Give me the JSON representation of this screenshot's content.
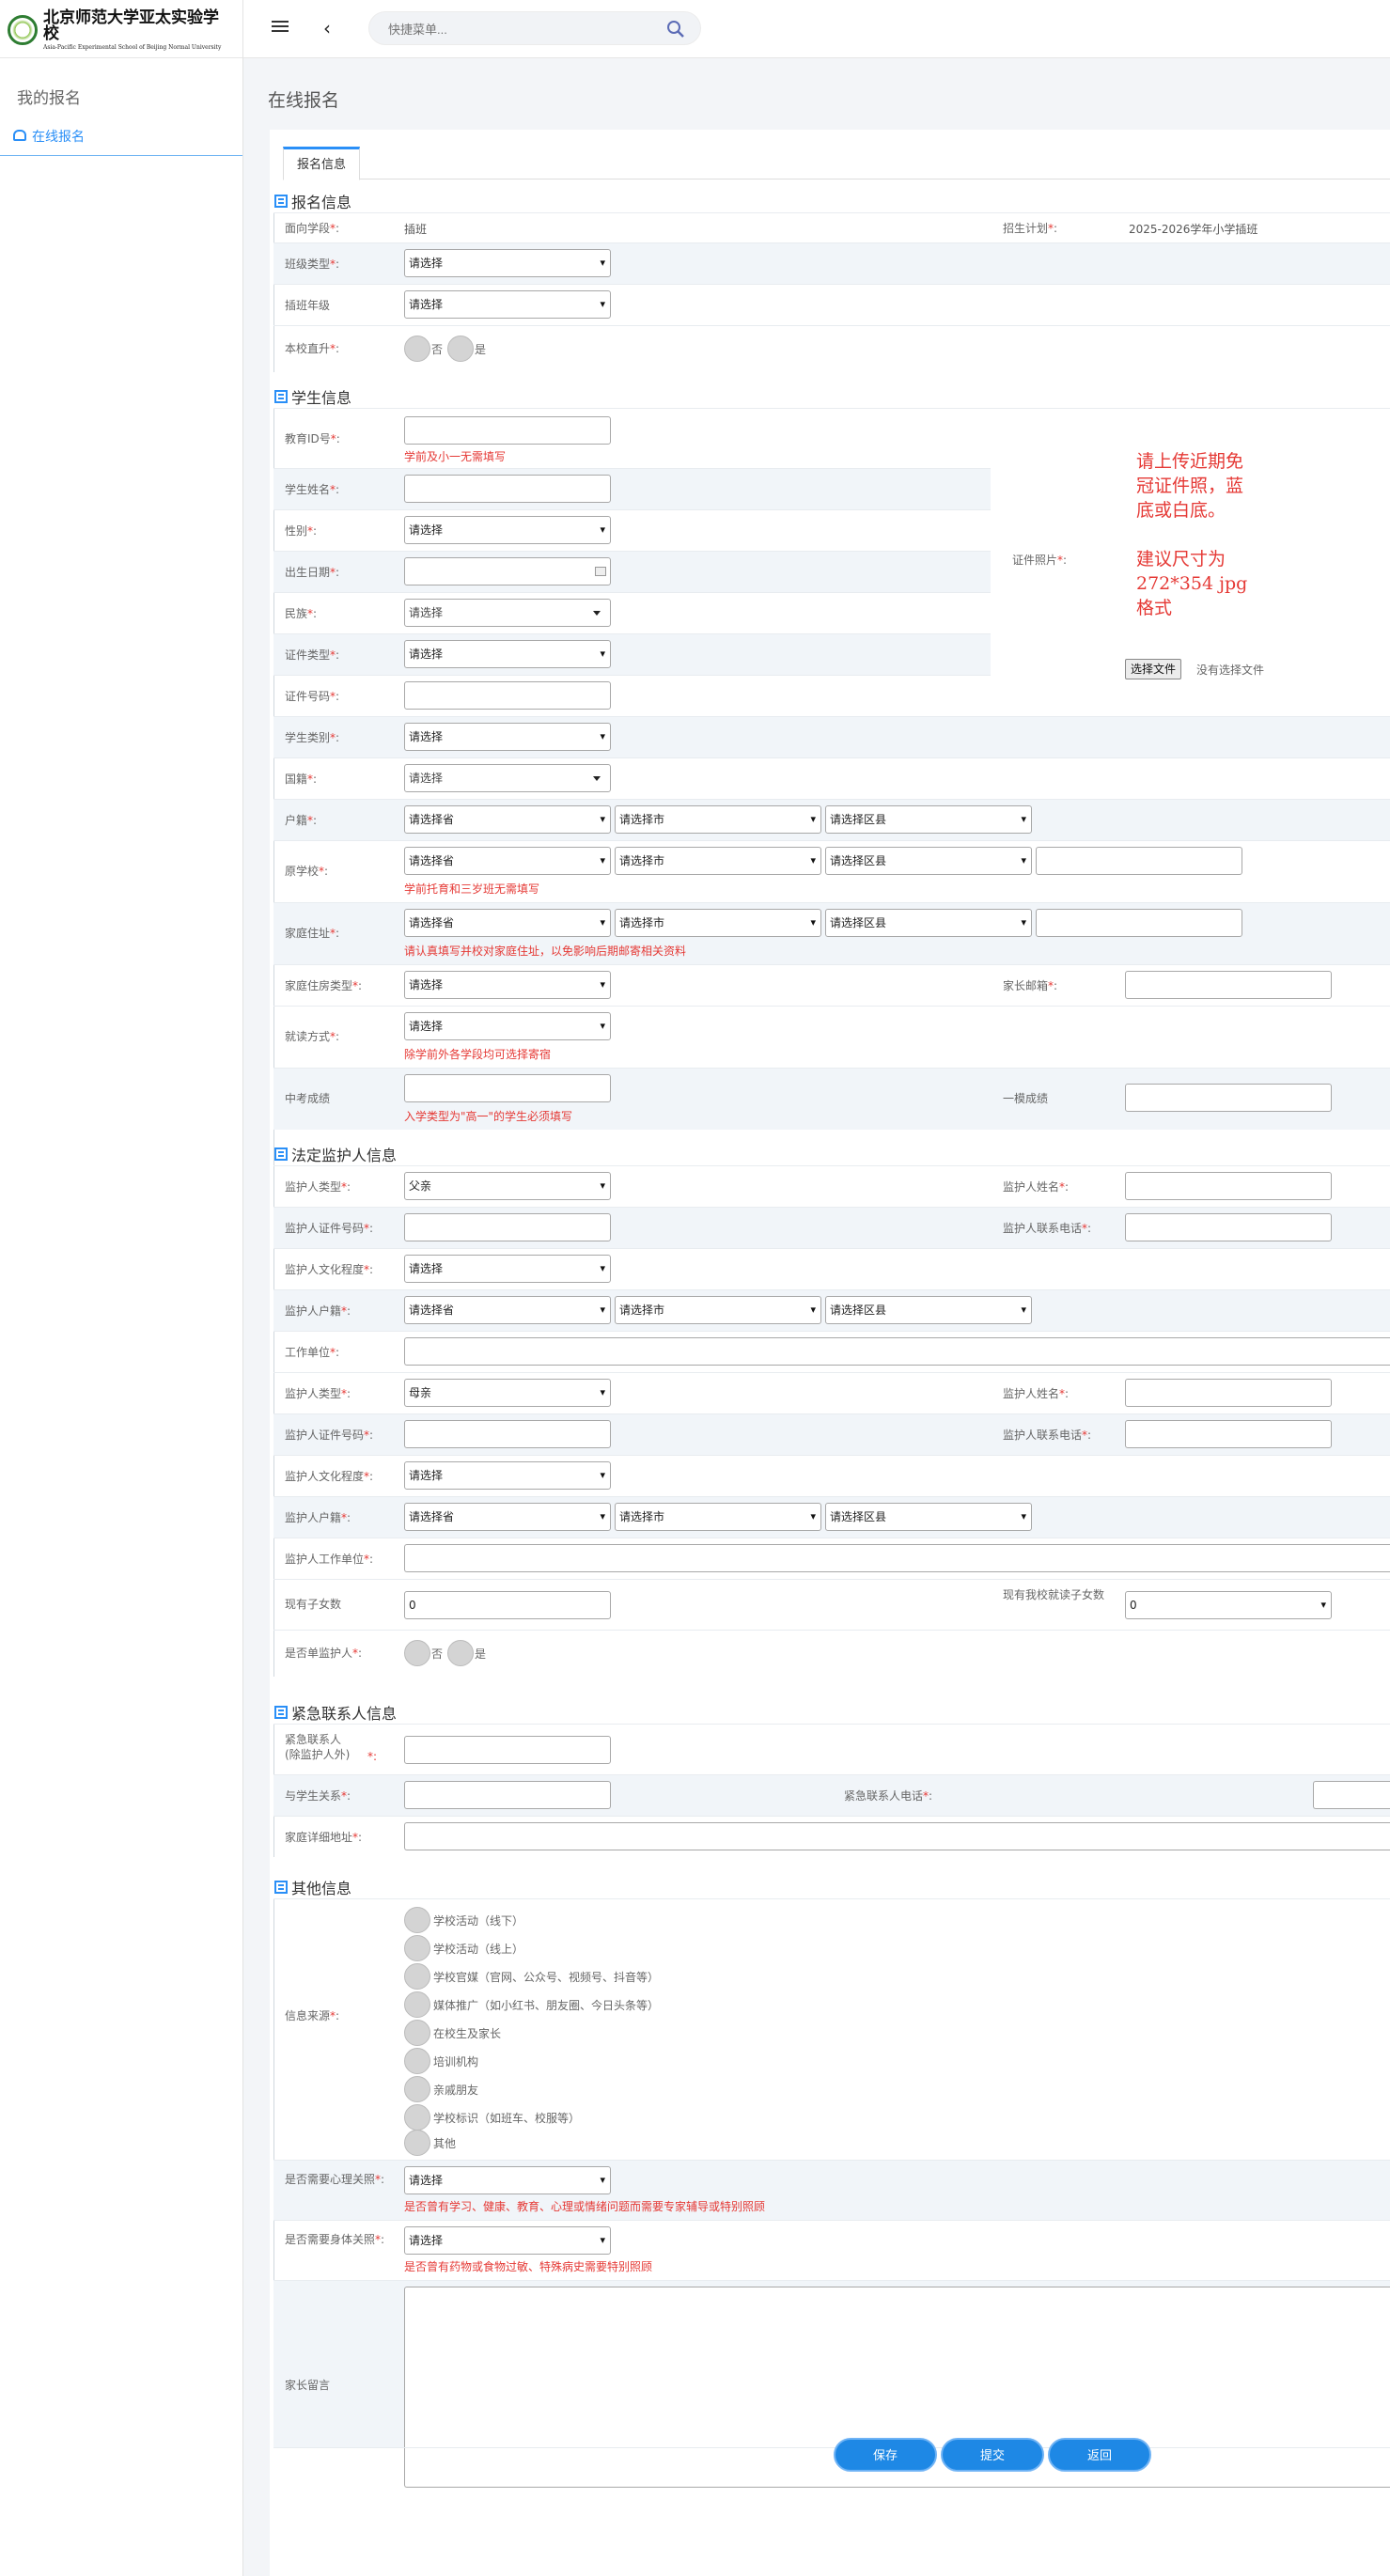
{
  "app": {
    "logo_cn": "北京师范大学亚太实验学校",
    "logo_en": "Asia-Pacific Experimental School of Beijing Normal University"
  },
  "topbar": {
    "search_placeholder": "快捷菜单..."
  },
  "sidebar": {
    "heading": "我的报名",
    "item": "在线报名"
  },
  "page": {
    "title": "在线报名",
    "tab": "报名信息"
  },
  "sections": {
    "enroll": "报名信息",
    "student": "学生信息",
    "guardian": "法定监护人信息",
    "emergency": "紧急联系人信息",
    "other": "其他信息"
  },
  "enroll": {
    "stage_label": "面向学段",
    "stage_value": "插班",
    "plan_label": "招生计划",
    "plan_value": "2025-2026学年小学插班",
    "class_type_label": "班级类型",
    "class_type_value": "请选择",
    "grade_label": "插班年级",
    "grade_value": "请选择",
    "promote_label": "本校直升",
    "no": "否",
    "yes": "是"
  },
  "student": {
    "edu_id_label": "教育ID号",
    "edu_id_hint": "学前及小一无需填写",
    "name_label": "学生姓名",
    "gender_label": "性别",
    "gender_value": "请选择",
    "birth_label": "出生日期",
    "nation_label": "民族",
    "nation_value": "请选择",
    "id_type_label": "证件类型",
    "id_type_value": "请选择",
    "id_no_label": "证件号码",
    "category_label": "学生类别",
    "category_value": "请选择",
    "country_label": "国籍",
    "country_value": "请选择",
    "photo_label": "证件照片",
    "photo_note": [
      "请上传近期免",
      "冠证件照，蓝",
      "底或白底。",
      "",
      "建议尺寸为",
      "272*354 jpg",
      "格式"
    ],
    "file_button": "选择文件",
    "file_status": "没有选择文件",
    "hukou_label": "户籍",
    "school_label": "原学校",
    "school_hint": "学前托育和三岁班无需填写",
    "address_label": "家庭住址",
    "address_hint": "请认真填写并校对家庭住址，以免影响后期邮寄相关资料",
    "housing_label": "家庭住房类型",
    "housing_value": "请选择",
    "email_label": "家长邮箱",
    "mode_label": "就读方式",
    "mode_value": "请选择",
    "mode_hint": "除学前外各学段均可选择寄宿",
    "zk_label": "中考成绩",
    "zk_hint": "入学类型为\"高一\"的学生必须填写",
    "ym_label": "一模成绩",
    "province": "请选择省",
    "city": "请选择市",
    "district": "请选择区县"
  },
  "guardian": {
    "type_label": "监护人类型",
    "type1_value": "父亲",
    "type2_value": "母亲",
    "name_label": "监护人姓名",
    "idno_label": "监护人证件号码",
    "phone_label": "监护人联系电话",
    "edu_label": "监护人文化程度",
    "edu_value": "请选择",
    "hukou_label": "监护人户籍",
    "work_label": "工作单位",
    "work2_label": "监护人工作单位",
    "children_label": "现有子女数",
    "children_value": "0",
    "school_children_label": "现有我校就读子女数",
    "school_children_value": "0",
    "single_label": "是否单监护人",
    "no": "否",
    "yes": "是"
  },
  "emergency": {
    "contact_label": "紧急联系人\n(除监护人外)",
    "relation_label": "与学生关系",
    "phone_label": "紧急联系人电话",
    "address_label": "家庭详细地址"
  },
  "other": {
    "source_label": "信息来源",
    "sources": [
      "学校活动（线下）",
      "学校活动（线上）",
      "学校官媒（官网、公众号、视频号、抖音等）",
      "媒体推广（如小红书、朋友圈、今日头条等）",
      "在校生及家长",
      "培训机构",
      "亲戚朋友",
      "学校标识（如班车、校服等）",
      "其他"
    ],
    "psych_label": "是否需要心理关照",
    "psych_value": "请选择",
    "psych_hint": "是否曾有学习、健康、教育、心理或情绪问题而需要专家辅导或特别照顾",
    "body_label": "是否需要身体关照",
    "body_value": "请选择",
    "body_hint": "是否曾有药物或食物过敏、特殊病史需要特别照顾",
    "message_label": "家长留言"
  },
  "buttons": {
    "save": "保存",
    "submit": "提交",
    "back": "返回"
  },
  "colors": {
    "accent": "#1e88e5",
    "required": "#e53935"
  }
}
